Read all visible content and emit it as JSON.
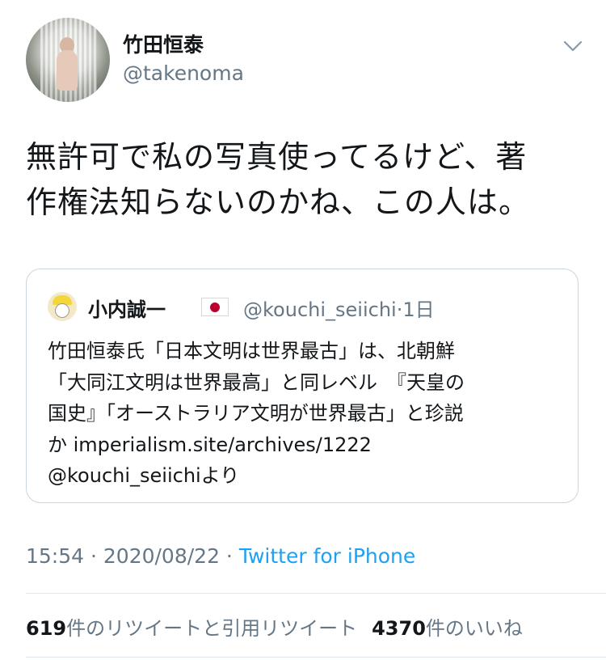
{
  "tweet": {
    "display_name": "竹田恒泰",
    "handle": "@takenoma",
    "text_line1": "無許可で私の写真使ってるけど、著",
    "text_line2": "作権法知らないのかね、この人は。"
  },
  "quoted": {
    "display_name": "小内誠一",
    "flag_icon": "japan-flag-icon",
    "handle": "@kouchi_seiichi",
    "age": "1日",
    "body_line1": "竹田恒泰氏「日本文明は世界最古」は、北朝鮮",
    "body_line2": "「大同江文明は世界最高」と同レベル　『天皇の",
    "body_line3": "国史』「オーストラリア文明が世界最古」と珍説",
    "body_line4": "か imperialism.site/archives/1222",
    "body_line5": "@kouchi_seiichiより"
  },
  "meta": {
    "time": "15:54",
    "date": "2020/08/22",
    "source": "Twitter for iPhone"
  },
  "stats": {
    "retweets_count": "619",
    "retweets_label": "件のリツイートと引用リツイート",
    "likes_count": "4370",
    "likes_label": "件のいいね"
  },
  "icons": {
    "caret": "chevron-down-icon"
  },
  "colors": {
    "text": "#14171a",
    "secondary": "#657786",
    "link": "#1da1f2",
    "border": "#ccd6dd"
  }
}
